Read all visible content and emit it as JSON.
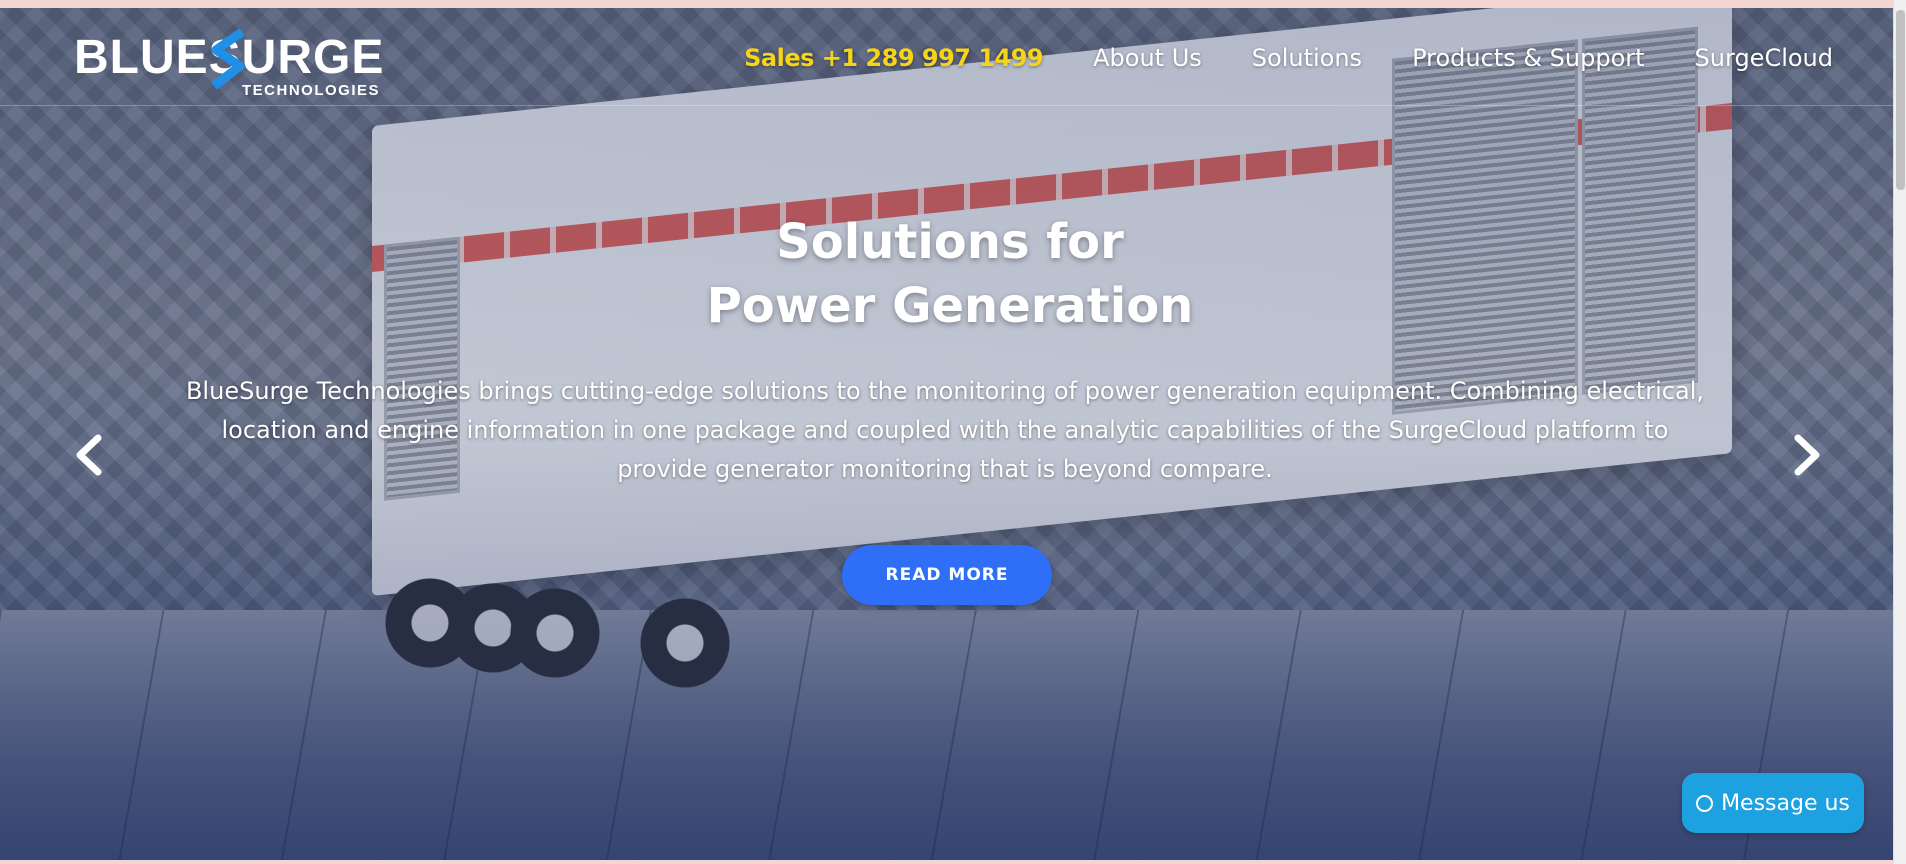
{
  "brand": {
    "logo_main": "BLUESURGE",
    "logo_sub": "TECHNOLOGIES"
  },
  "nav": {
    "sales": "Sales +1 289 997 1499",
    "items": [
      "About Us",
      "Solutions",
      "Products & Support",
      "SurgeCloud"
    ]
  },
  "hero": {
    "title_line1": "Solutions for",
    "title_line2": "Power Generation",
    "description": "BlueSurge Technologies brings cutting-edge solutions to the monitoring of power generation equipment. Combining electrical, location and engine information in one package and coupled with the analytic capabilities of the SurgeCloud platform to provide generator monitoring that is beyond compare.",
    "button_label": "READ MORE",
    "prev_icon": "chevron-left-icon",
    "next_icon": "chevron-right-icon"
  },
  "chat": {
    "label": "Message us"
  },
  "colors": {
    "sales_text": "#f6d417",
    "button_bg": "#2f6ef7",
    "chat_bg": "#1da1e0"
  }
}
